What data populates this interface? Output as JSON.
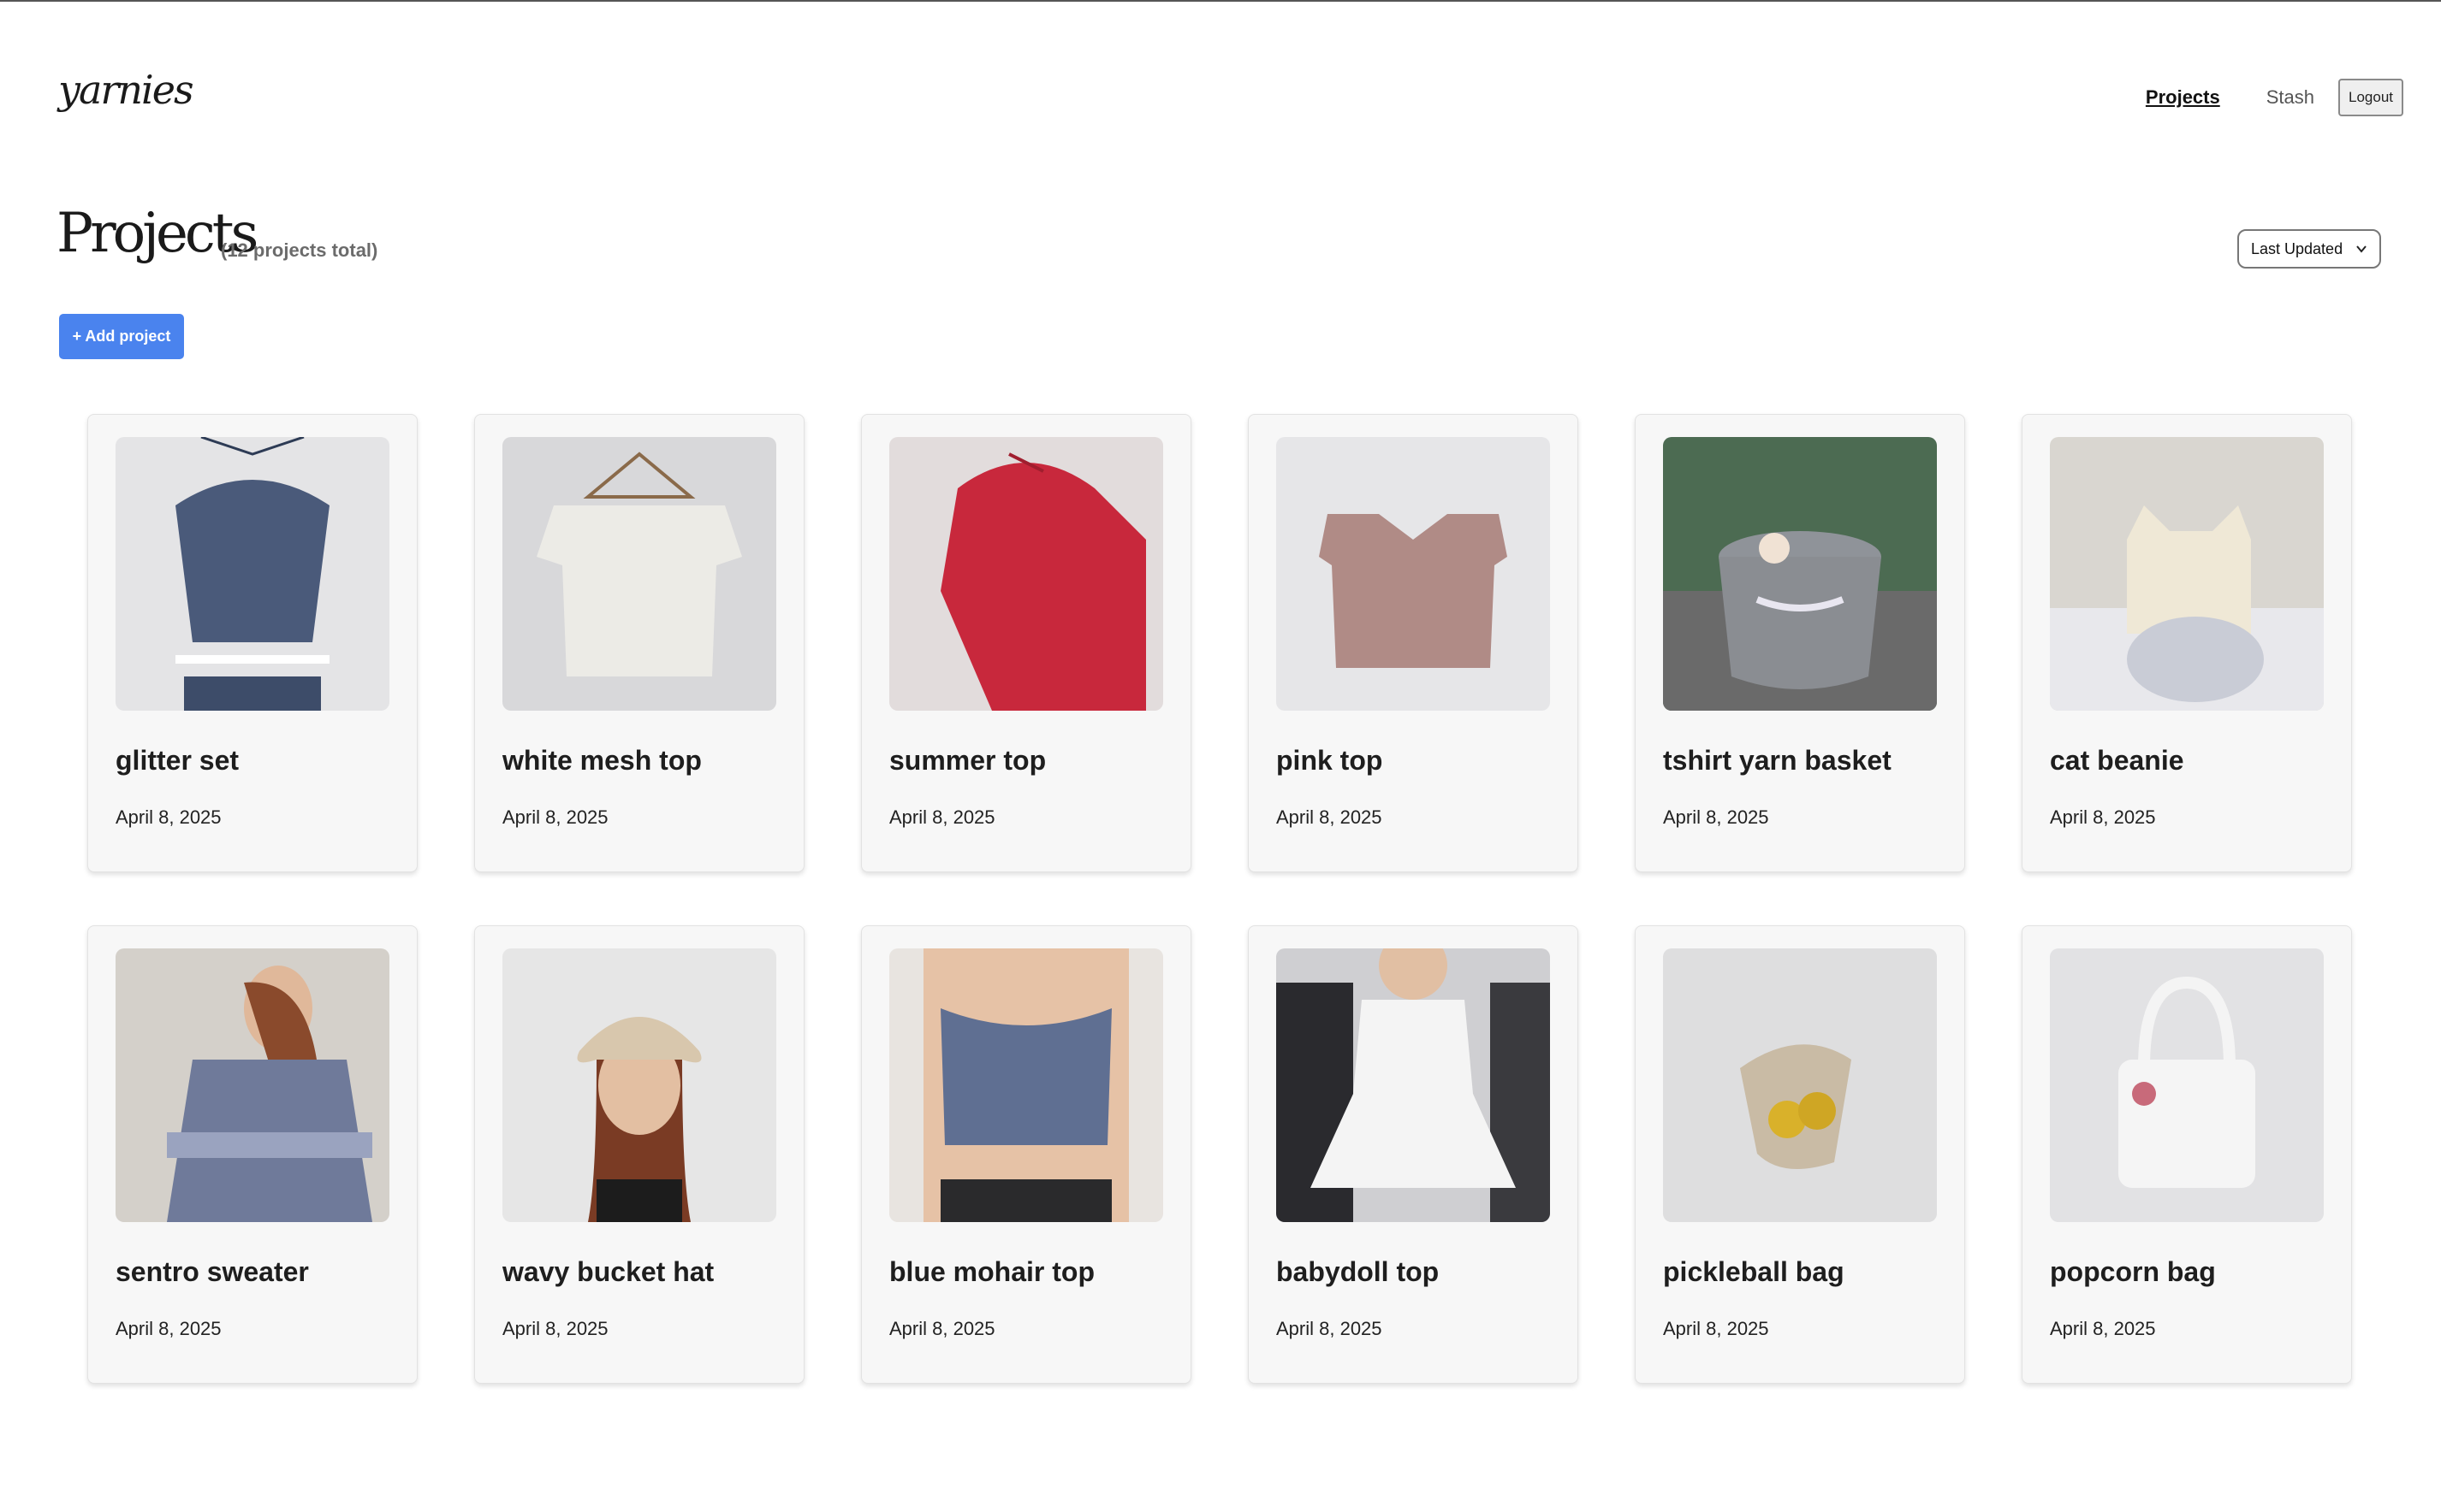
{
  "header": {
    "logo": "yarnies",
    "nav": {
      "projects": "Projects",
      "stash": "Stash",
      "logout": "Logout"
    }
  },
  "page": {
    "title": "Projects",
    "total": "(12 projects total)",
    "sort_selected": "Last Updated",
    "add_button": "+ Add project"
  },
  "projects": [
    {
      "title": "glitter set",
      "date": "April 8, 2025"
    },
    {
      "title": "white mesh top",
      "date": "April 8, 2025"
    },
    {
      "title": "summer top",
      "date": "April 8, 2025"
    },
    {
      "title": "pink top",
      "date": "April 8, 2025"
    },
    {
      "title": "tshirt yarn basket",
      "date": "April 8, 2025"
    },
    {
      "title": "cat beanie",
      "date": "April 8, 2025"
    },
    {
      "title": "sentro sweater",
      "date": "April 8, 2025"
    },
    {
      "title": "wavy bucket hat",
      "date": "April 8, 2025"
    },
    {
      "title": "blue mohair top",
      "date": "April 8, 2025"
    },
    {
      "title": "babydoll top",
      "date": "April 8, 2025"
    },
    {
      "title": "pickleball bag",
      "date": "April 8, 2025"
    },
    {
      "title": "popcorn bag",
      "date": "April 8, 2025"
    }
  ],
  "colors": {
    "accent": "#4a83ee",
    "card_bg": "#f7f7f7"
  }
}
